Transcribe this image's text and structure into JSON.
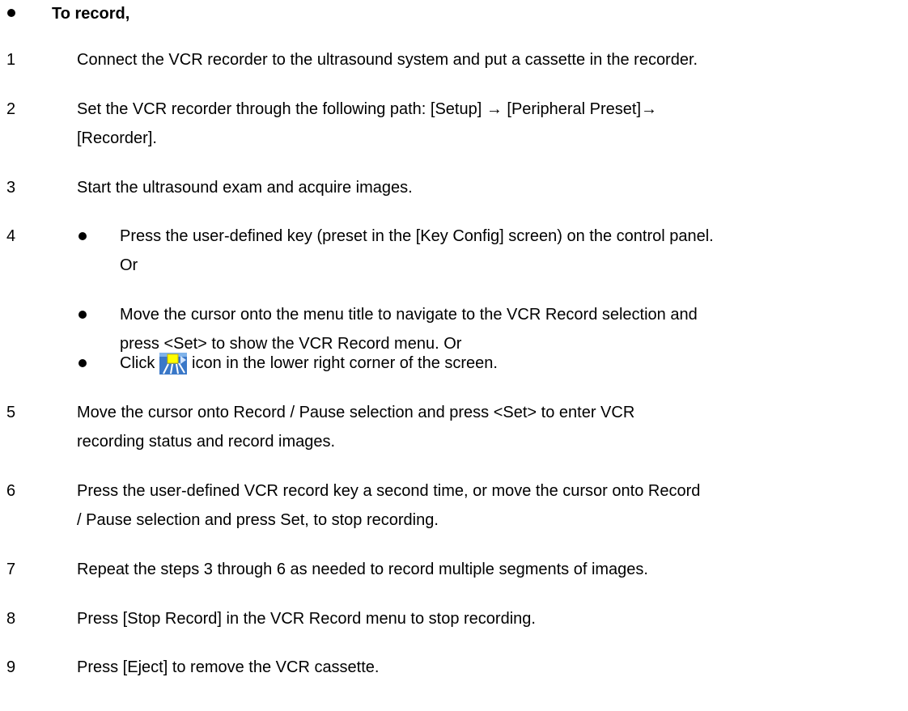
{
  "heading": "To record,",
  "steps": [
    {
      "num": "1",
      "lines": [
        "Connect the VCR recorder to the ultrasound system and put a cassette in the recorder."
      ]
    },
    {
      "num": "2",
      "lines": [
        "Set the VCR recorder through the following path: [Setup] → [Peripheral Preset]→",
        "[Recorder]."
      ]
    },
    {
      "num": "3",
      "lines": [
        "Start the ultrasound exam and acquire images."
      ]
    },
    {
      "num": "4",
      "sub": [
        {
          "lines": [
            "Press the user-defined key (preset in the [Key Config] screen) on the control panel.",
            "Or"
          ]
        },
        {
          "lines": [
            "Move the cursor onto the menu title to navigate to the VCR Record selection and",
            "press <Set> to show the VCR Record menu. Or"
          ]
        },
        {
          "prefix": "Click",
          "icon": "vcr-record-icon",
          "suffix": "icon in the lower right corner of the screen."
        }
      ]
    },
    {
      "num": "5",
      "lines": [
        "Move the cursor onto Record / Pause selection and press <Set> to enter VCR",
        "recording status and record images."
      ]
    },
    {
      "num": "6",
      "lines": [
        "Press the user-defined VCR record key a second time, or move the cursor onto Record",
        "/ Pause selection and press Set, to stop recording."
      ]
    },
    {
      "num": "7",
      "lines": [
        "Repeat the steps 3 through 6 as needed to record multiple segments of images."
      ]
    },
    {
      "num": "8",
      "lines": [
        "Press [Stop Record] in the VCR Record menu to stop recording."
      ]
    },
    {
      "num": "9",
      "lines": [
        "Press [Eject] to remove the VCR cassette."
      ]
    }
  ]
}
